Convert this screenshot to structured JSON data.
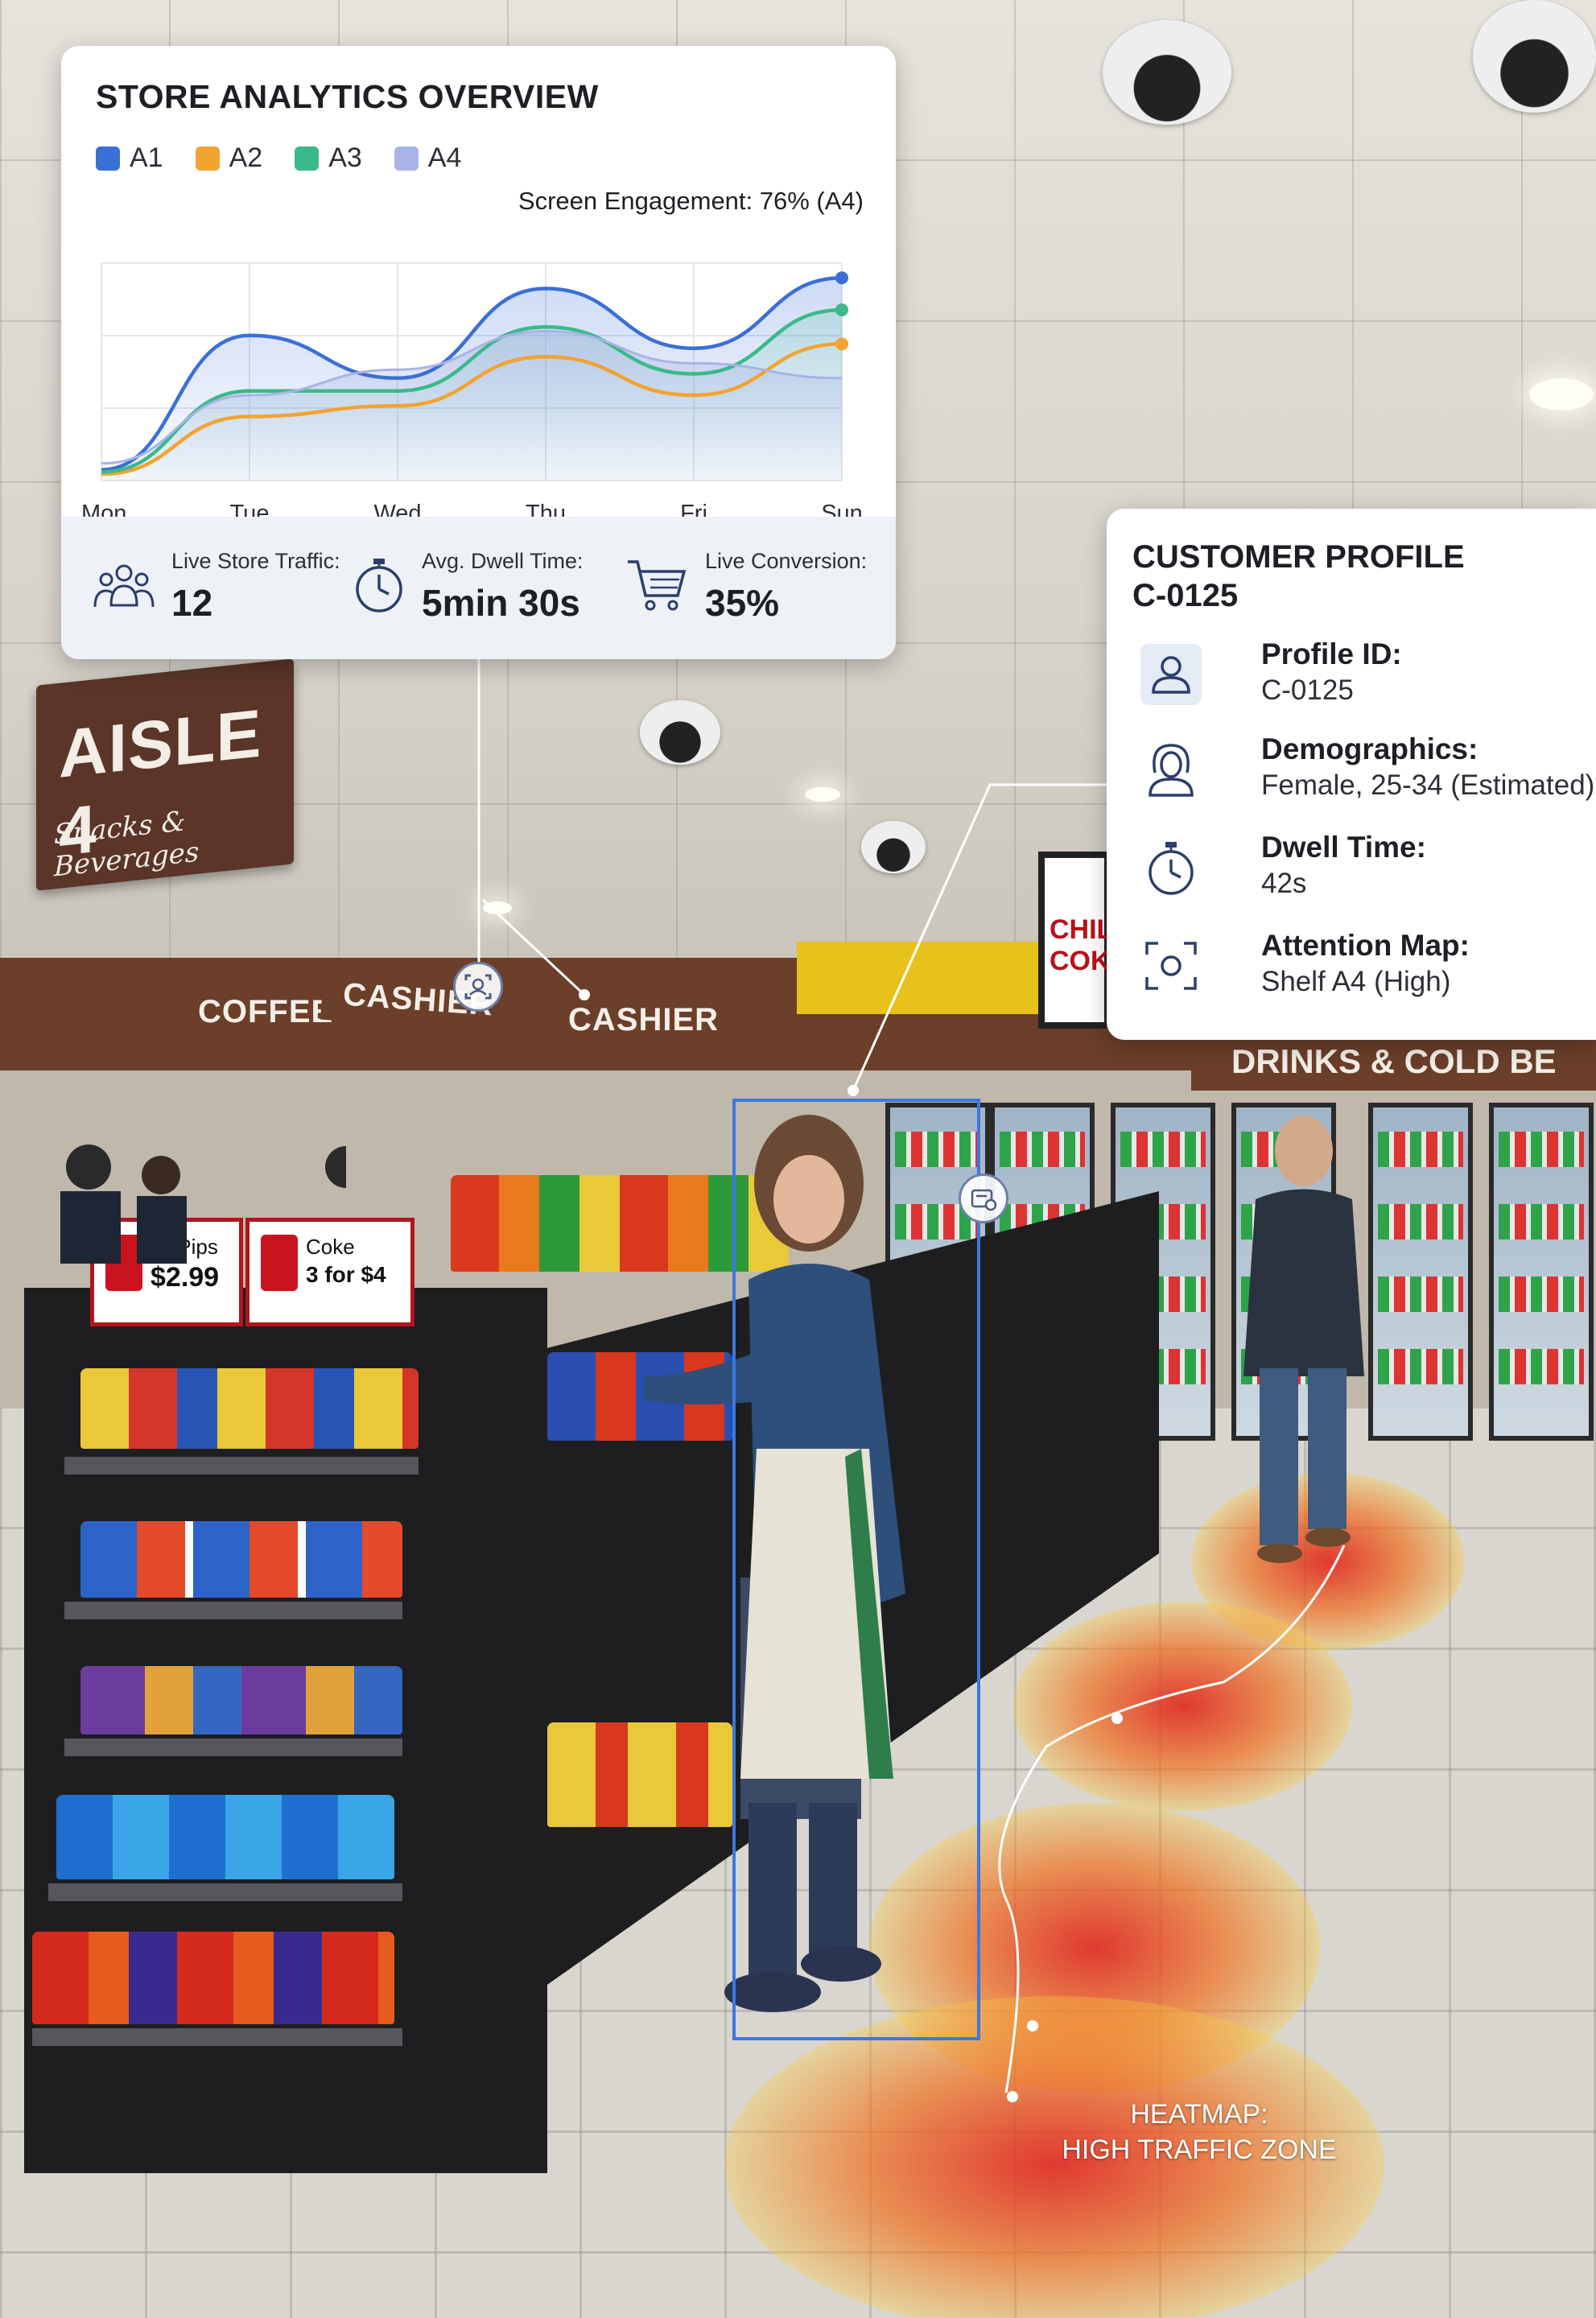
{
  "analytics": {
    "title": "STORE ANALYTICS OVERVIEW",
    "legend": [
      {
        "name": "A1",
        "color": "#3a6fd8"
      },
      {
        "name": "A2",
        "color": "#f2a330"
      },
      {
        "name": "A3",
        "color": "#3bb98a"
      },
      {
        "name": "A4",
        "color": "#a9b3e6"
      }
    ],
    "engagement_label": "Screen Engagement: 76% (A4)",
    "days": [
      "Mon",
      "Tue",
      "Wed",
      "Thu",
      "Fri",
      "Sun"
    ],
    "stats": {
      "traffic_label": "Live Store Traffic:",
      "traffic_value": "12",
      "dwell_label": "Avg. Dwell Time:",
      "dwell_value": "5min 30s",
      "conversion_label": "Live Conversion:",
      "conversion_value": "35%"
    }
  },
  "chart_data": {
    "type": "area",
    "categories": [
      "Mon",
      "Tue",
      "Wed",
      "Thu",
      "Fri",
      "Sun"
    ],
    "series": [
      {
        "name": "A1",
        "values": [
          5,
          68,
          48,
          90,
          62,
          95
        ]
      },
      {
        "name": "A2",
        "values": [
          3,
          30,
          35,
          58,
          40,
          64
        ]
      },
      {
        "name": "A3",
        "values": [
          4,
          42,
          42,
          72,
          50,
          80
        ]
      },
      {
        "name": "A4",
        "values": [
          8,
          40,
          52,
          70,
          55,
          48
        ]
      }
    ],
    "ylim": [
      0,
      100
    ],
    "grid": true,
    "legend": "top-left"
  },
  "profile": {
    "title_line1": "CUSTOMER PROFILE",
    "title_line2": "C-0125",
    "rows": [
      {
        "label": "Profile ID:",
        "value": "C-0125",
        "icon": "user-icon"
      },
      {
        "label": "Demographics:",
        "value": "Female, 25-34 (Estimated)",
        "icon": "female-avatar-icon"
      },
      {
        "label": "Dwell Time:",
        "value": "42s",
        "icon": "stopwatch-icon"
      },
      {
        "label": "Attention Map:",
        "value": "Shelf A4 (High)",
        "icon": "focus-target-icon"
      }
    ]
  },
  "scene": {
    "aisle_title": "AISLE 4",
    "aisle_subtitle": "Snacks & Beverages",
    "coffee_sign": "COFFEE",
    "cashier_sign_1": "CASHIER",
    "cashier_sign_2": "CASHIER",
    "drinks_sign": "DRINKS & COLD BE",
    "screen_text": "CHILL COKE",
    "price_tag_1_name": "DoPips",
    "price_tag_1_price": "$2.99",
    "price_tag_2_name": "Coke",
    "price_tag_2_price": "3 for $4",
    "heatmap_line1": "HEATMAP:",
    "heatmap_line2": "HIGH TRAFFIC ZONE"
  }
}
